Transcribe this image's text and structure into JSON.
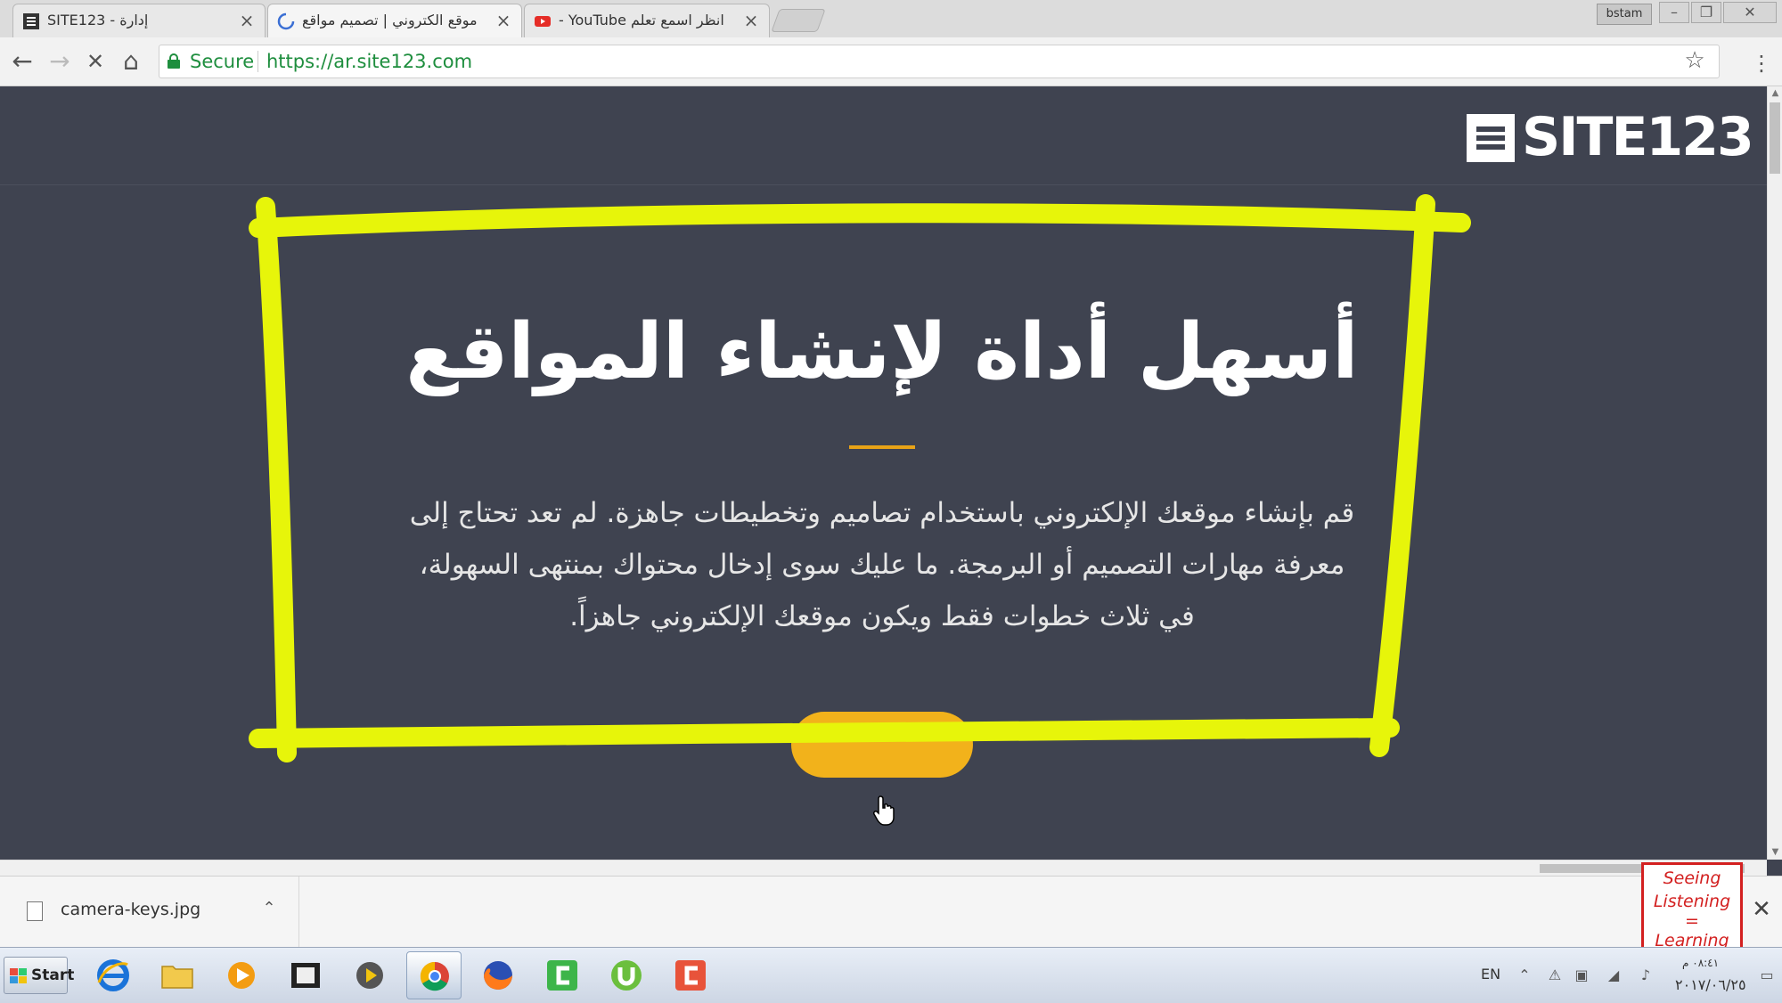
{
  "browser": {
    "tabs": [
      {
        "title": "SITE123 - إدارة",
        "close": "×"
      },
      {
        "title": "موقع الكتروني | تصميم مواقع",
        "close": "×"
      },
      {
        "title": "- YouTube انظر اسمع تعلم",
        "close": "×"
      }
    ],
    "profile_badge": "bstam",
    "window_buttons": {
      "minimize": "–",
      "restore": "❐",
      "close": "✕"
    },
    "nav": {
      "back": "←",
      "forward": "→",
      "stop": "✕",
      "home": "⌂"
    },
    "secure_label": "Secure",
    "url": "https://ar.site123.com",
    "star": "☆",
    "menu": "⋮"
  },
  "page": {
    "logo_text": "SITE123",
    "hero_title": "أسهل أداة لإنشاء المواقع",
    "hero_lines": [
      "قم بإنشاء موقعك الإلكتروني باستخدام تصاميم وتخطيطات جاهزة. لم تعد تحتاج إلى",
      "معرفة مهارات التصميم أو البرمجة. ما عليك سوى إدخال محتواك بمنتهى السهولة،",
      "في ثلاث خطوات فقط ويكون موقعك الإلكتروني جاهزاً."
    ],
    "accent_color": "#e8a317",
    "button_color": "#f2b21b",
    "highlight_color": "#e7f50a"
  },
  "download": {
    "file_name": "camera-keys.jpg",
    "chevron": "⌃",
    "close": "✕"
  },
  "watermark": {
    "lines": [
      "Seeing",
      "Listening",
      "=",
      "Learning"
    ]
  },
  "taskbar": {
    "start_label": "Start",
    "lang": "EN",
    "time": "٠٨:٤١ م",
    "date": "٢٠١٧/٠٦/٢٥",
    "apps": [
      "ie-icon",
      "folder-icon",
      "media-player-icon",
      "film-icon",
      "video-editor-icon",
      "chrome-icon",
      "firefox-icon",
      "camtasia-green-icon",
      "utorrent-icon",
      "camtasia-red-icon"
    ]
  }
}
